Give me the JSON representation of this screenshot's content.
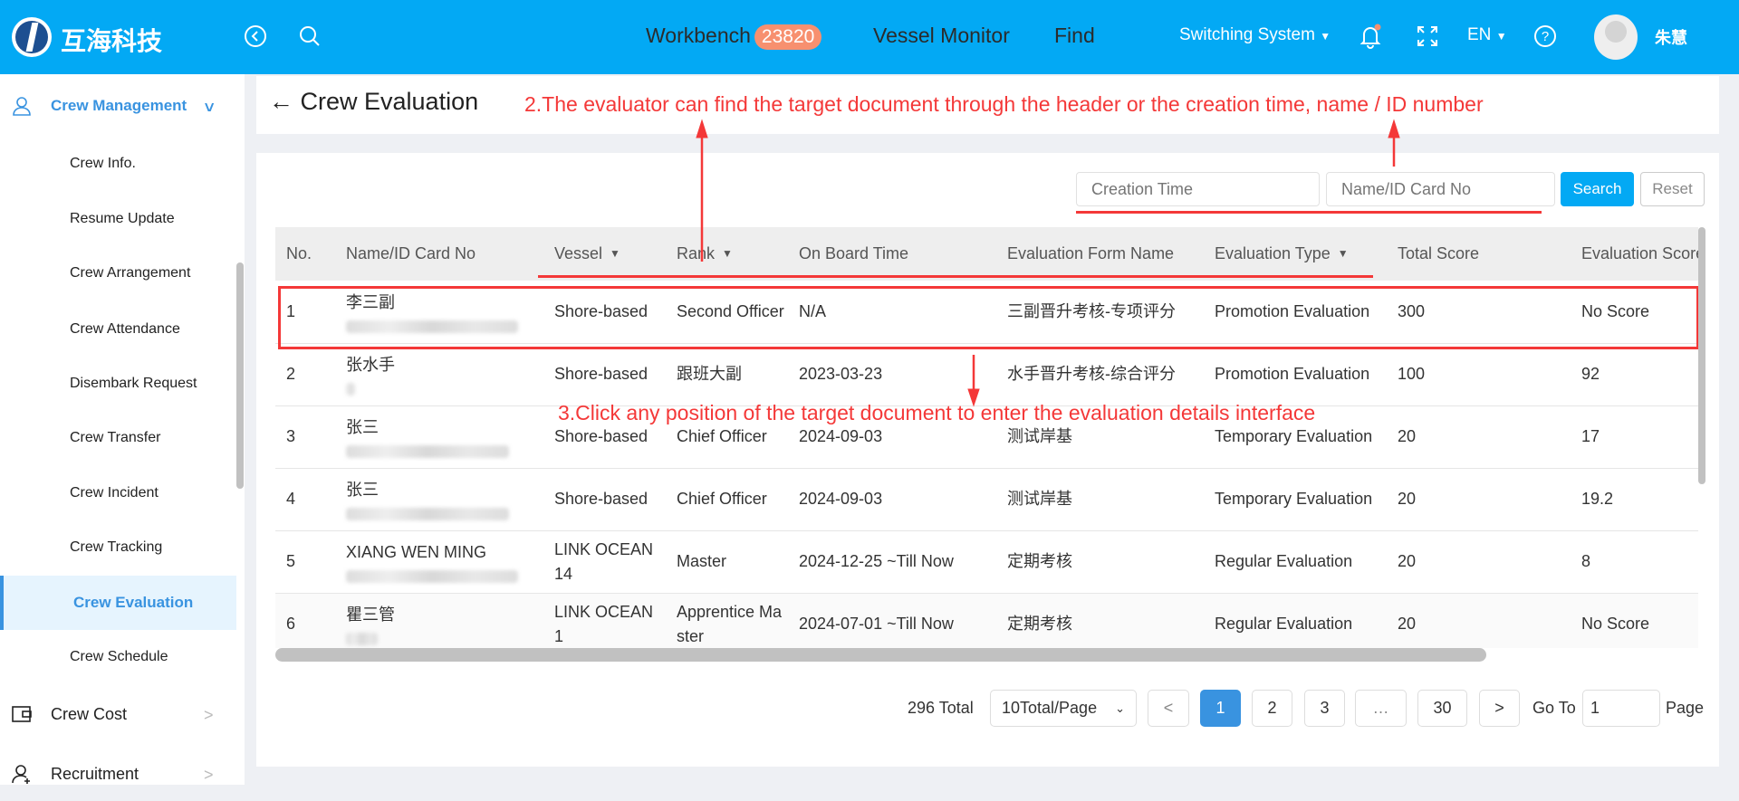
{
  "header": {
    "brand": "互海科技",
    "nav": [
      {
        "label": "Workbench",
        "badge": "23820"
      },
      {
        "label": "Vessel Monitor"
      },
      {
        "label": "Find"
      }
    ],
    "switching": "Switching System",
    "lang": "EN",
    "user": "朱慧"
  },
  "sidebar": {
    "group": "Crew Management",
    "items": [
      "Crew Info.",
      "Resume Update",
      "Crew Arrangement",
      "Crew Attendance",
      "Disembark Request",
      "Crew Transfer",
      "Crew Incident",
      "Crew Tracking",
      "Crew Evaluation",
      "Crew Schedule"
    ],
    "active": "Crew Evaluation",
    "others": [
      "Crew Cost",
      "Recruitment"
    ]
  },
  "page": {
    "title": "Crew Evaluation"
  },
  "annotations": {
    "a2": "2.The evaluator can find the target document through the header or the creation time, name / ID number",
    "a3": "3.Click any position of the target document to enter the evaluation details interface"
  },
  "filters": {
    "creation_placeholder": "Creation Time",
    "name_placeholder": "Name/ID Card No",
    "search": "Search",
    "reset": "Reset"
  },
  "table": {
    "columns": [
      "No.",
      "Name/ID Card No",
      "Vessel",
      "Rank",
      "On Board Time",
      "Evaluation Form Name",
      "Evaluation Type",
      "Total Score",
      "Evaluation Score"
    ],
    "rows": [
      [
        "1",
        "李三副",
        "Shore-based",
        "Second Officer",
        "N/A",
        "三副晋升考核-专项评分",
        "Promotion Evaluation",
        "300",
        "No Score"
      ],
      [
        "2",
        "张水手",
        "Shore-based",
        "跟班大副",
        "2023-03-23",
        "水手晋升考核-综合评分",
        "Promotion Evaluation",
        "100",
        "92"
      ],
      [
        "3",
        "张三",
        "Shore-based",
        "Chief Officer",
        "2024-09-03",
        "测试岸基",
        "Temporary Evaluation",
        "20",
        "17"
      ],
      [
        "4",
        "张三",
        "Shore-based",
        "Chief Officer",
        "2024-09-03",
        "测试岸基",
        "Temporary Evaluation",
        "20",
        "19.2"
      ],
      [
        "5",
        "XIANG WEN MING",
        "LINK OCEAN 14",
        "Master",
        "2024-12-25 ~Till Now",
        "定期考核",
        "Regular Evaluation",
        "20",
        "8"
      ],
      [
        "6",
        "瞿三管",
        "LINK OCEAN 1",
        "Apprentice Master",
        "2024-07-01 ~Till Now",
        "定期考核",
        "Regular Evaluation",
        "20",
        "No Score"
      ]
    ]
  },
  "pagination": {
    "total": "296 Total",
    "page_size": "10Total/Page",
    "prev": "<",
    "pages": [
      "1",
      "2",
      "3",
      "…",
      "30"
    ],
    "current": "1",
    "next": ">",
    "goto": "Go To",
    "goto_value": "1",
    "page_label": "Page"
  },
  "colors": {
    "primary": "#03a9f4",
    "active": "#3993e0",
    "annotation": "#f43838",
    "badge": "#f7906f"
  }
}
